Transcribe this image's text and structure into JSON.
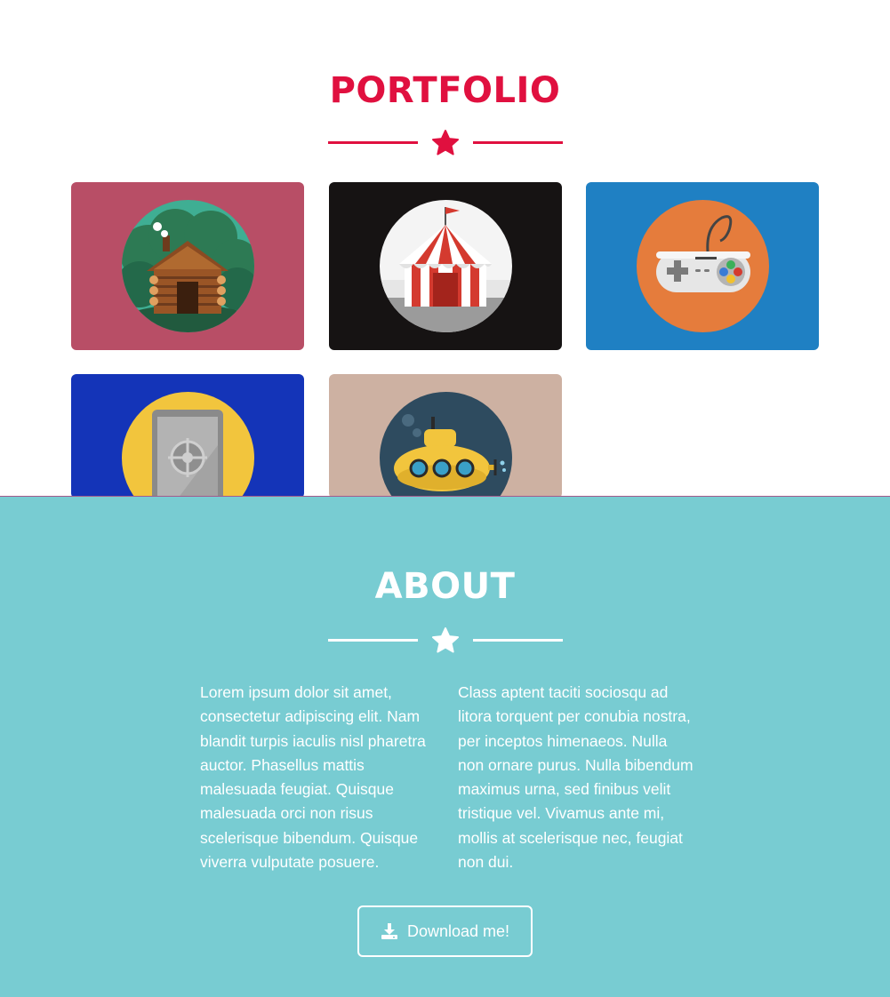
{
  "portfolio": {
    "title": "PORTFOLIO",
    "accent_color": "#e0103f",
    "divider_icon": "star-icon",
    "items": [
      {
        "name": "cabin",
        "icon": "log-cabin-icon",
        "bg": "#b84e66"
      },
      {
        "name": "circus",
        "icon": "circus-tent-icon",
        "bg": "#161313"
      },
      {
        "name": "game",
        "icon": "game-controller-icon",
        "bg": "#1f80c3"
      },
      {
        "name": "safe",
        "icon": "safe-icon",
        "bg": "#1434b8"
      },
      {
        "name": "submarine",
        "icon": "submarine-icon",
        "bg": "#cdb1a2"
      }
    ]
  },
  "about": {
    "title": "ABOUT",
    "bg_color": "#78ccd2",
    "divider_icon": "star-icon",
    "paragraph_left": "Lorem ipsum dolor sit amet, consectetur adipiscing elit. Nam blandit turpis iaculis nisl pharetra auctor. Phasellus mattis malesuada feugiat. Quisque malesuada orci non risus scelerisque bibendum. Quisque viverra vulputate posuere.",
    "paragraph_right": "Class aptent taciti sociosqu ad litora torquent per conubia nostra, per inceptos himenaeos. Nulla non ornare purus. Nulla bibendum maximus urna, sed finibus velit tristique vel. Vivamus ante mi, mollis at scelerisque nec, feugiat non dui.",
    "download_button": {
      "label": "Download me!",
      "icon": "download-icon"
    }
  }
}
